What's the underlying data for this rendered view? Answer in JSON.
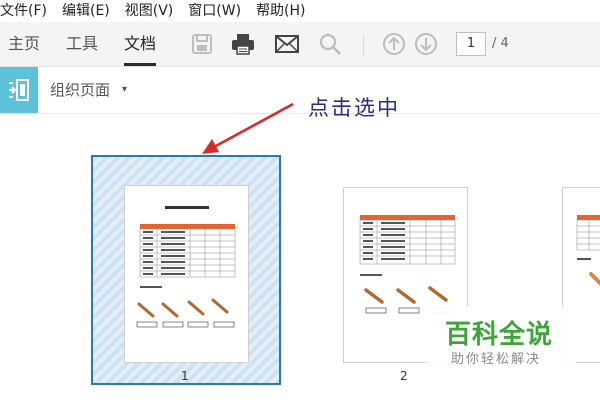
{
  "menu": [
    "文件(F)",
    "编辑(E)",
    "视图(V)",
    "窗口(W)",
    "帮助(H)"
  ],
  "tabs": {
    "home": "主页",
    "tools": "工具",
    "document": "文档"
  },
  "toolbar": {
    "icons": [
      "save-icon",
      "print-icon",
      "email-icon",
      "search-icon",
      "page-up-icon",
      "page-down-icon"
    ],
    "current_page": "1",
    "page_total": "/ 4"
  },
  "subbar": {
    "label": "组织页面",
    "caret": "▾"
  },
  "annotation": {
    "text": "点击选中",
    "color": "#2b2b8a"
  },
  "thumbnails": [
    {
      "number": "1",
      "selected": true
    },
    {
      "number": "2",
      "selected": false
    }
  ],
  "watermark": {
    "title": "百科全说",
    "subtitle": "助你轻松解决"
  },
  "colors": {
    "accent": "#5bc2d9",
    "selection_border": "#2c78b4",
    "arrow": "#d62b2b",
    "table_header": "#e8622c",
    "watermark_green": "#3ba535"
  }
}
